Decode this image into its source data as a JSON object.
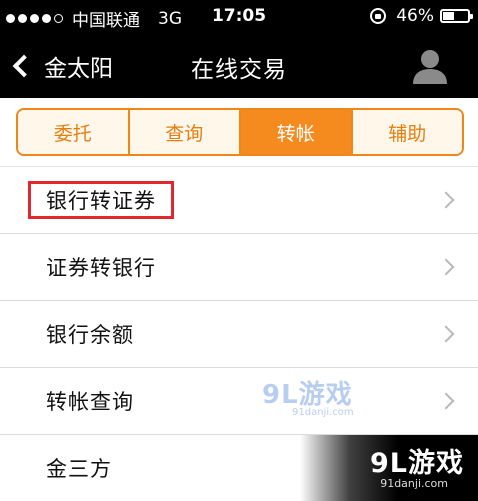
{
  "status_bar": {
    "carrier": "中国联通",
    "network": "3G",
    "time": "17:05",
    "battery_text": "46%",
    "battery_level": 0.46,
    "signal_bars_filled": 4,
    "signal_bars_total": 5
  },
  "nav": {
    "back_label": "金太阳",
    "title": "在线交易",
    "back_icon": "chevron-left-icon",
    "user_icon": "user-avatar-icon"
  },
  "tabs": [
    {
      "label": "委托",
      "active": false
    },
    {
      "label": "查询",
      "active": false
    },
    {
      "label": "转帐",
      "active": true
    },
    {
      "label": "辅助",
      "active": false
    }
  ],
  "menu": [
    {
      "label": "银行转证券",
      "highlighted": true
    },
    {
      "label": "证券转银行",
      "highlighted": false
    },
    {
      "label": "银行余额",
      "highlighted": false
    },
    {
      "label": "转帐查询",
      "highlighted": false
    },
    {
      "label": "金三方",
      "highlighted": false
    }
  ],
  "watermark": {
    "mid_main": "9L游戏",
    "mid_sub": "91danji.com",
    "corner_main": "9L游戏",
    "corner_sub": "91danji.com"
  },
  "colors": {
    "accent": "#f58a1f",
    "tab_text": "#e47e12",
    "highlight": "#e0282e"
  }
}
